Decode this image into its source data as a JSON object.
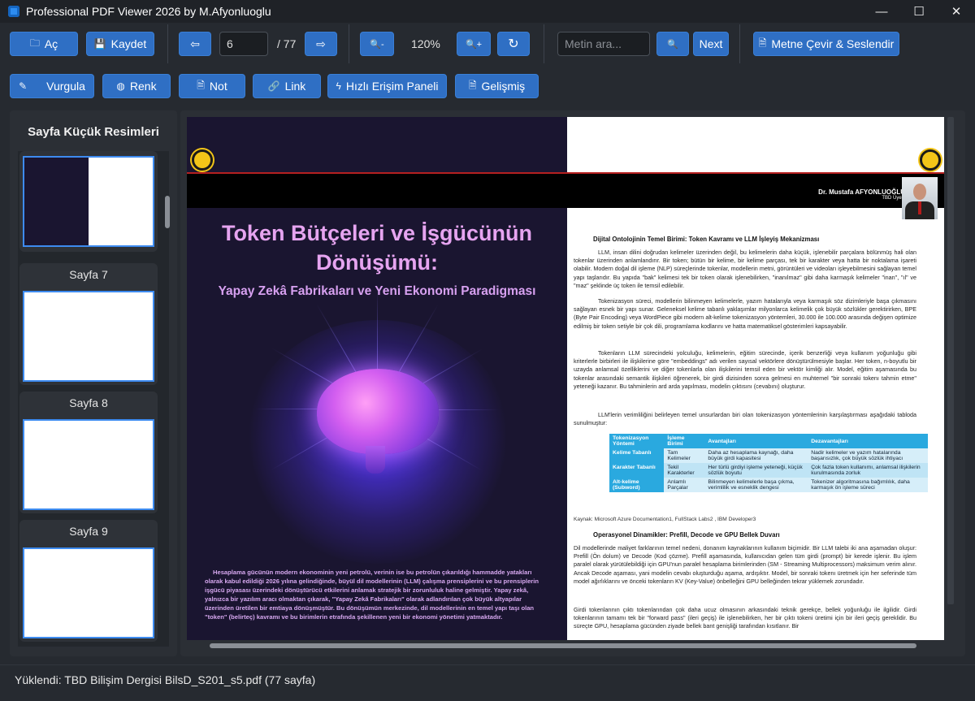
{
  "window": {
    "title": "Professional PDF Viewer 2026 by M.Afyonluoglu",
    "minimize": "—",
    "maximize": "☐",
    "close": "✕"
  },
  "toolbar1": {
    "open_label": "Aç",
    "save_label": "Kaydet",
    "prev_icon": "⇦",
    "page_value": "6",
    "page_total": "/ 77",
    "next_icon": "⇨",
    "zoom_out_icon": "🔍-",
    "zoom_level": "120%",
    "zoom_in_icon": "🔍+",
    "rotate_icon": "↻",
    "search_placeholder": "Metin ara...",
    "search_icon": "🔍",
    "next_label": "Next",
    "translate_label": "Metne Çevir & Seslendir"
  },
  "toolbar2": {
    "highlight_label": "Vurgula",
    "color_label": "Renk",
    "note_label": "Not",
    "link_label": "Link",
    "quick_access_label": "Hızlı Erişim Paneli",
    "advanced_label": "Gelişmiş"
  },
  "sidebar": {
    "title": "Sayfa Küçük Resimleri",
    "thumbnails": [
      {
        "label": ""
      },
      {
        "label": "Sayfa 7"
      },
      {
        "label": "Sayfa 8"
      },
      {
        "label": "Sayfa 9"
      }
    ]
  },
  "document": {
    "author_name": "Dr. Mustafa  AFYONLUOĞLU",
    "author_role": "TBD Üyesi",
    "title_line1": "Token Bütçeleri ve İşgücünün",
    "title_line2": "Dönüşümü:",
    "subtitle": "Yapay Zekâ Fabrikaları ve Yeni Ekonomi Paradigması",
    "left_body": "Hesaplama gücünün modern ekonominin yeni petrolü, verinin ise bu petrolün çıkarıldığı hammadde yatakları olarak kabul edildiği 2026 yılına gelindiğinde, büyül dil modellerinin (LLM) çalışma prensiplerini ve bu prensiplerin işgücü piyasası üzerindeki dönüştürücü etkilerini anlamak stratejik bir zorunluluk haline gelmiştir. Yapay zekâ, yalnızca bir yazılım aracı olmaktan çıkarak, \"Yapay Zekâ Fabrikaları\" olarak adlandırılan çok büyük altyapılar üzerinden üretilen bir emtiaya dönüşmüştür. Bu dönüşümün merkezinde, dil modellerinin en temel yapı taşı olan \"token\" (belirteç) kavramı ve bu birimlerin etrafında şekillenen yeni bir ekonomi yönetimi yatmaktadır.",
    "section1_heading": "Dijital Ontolojinin Temel Birimi: Token Kavramı ve LLM İşleyiş Mekanizması",
    "para1": "LLM, insan dilini doğrudan kelimeler üzerinden değil, bu kelimelerin daha küçük, işlenebilir parçalara bölünmüş hali olan tokenlar üzerinden anlamlandırır. Bir token; bütün bir kelime, bir kelime parçası, tek bir karakter veya hatta bir noktalama işareti olabilir. Modern doğal dil işleme (NLP) süreçlerinde tokenlar, modellerin metni, görüntüleri ve videoları işleyebilmesini sağlayan temel yapı taşlarıdır. Bu yapıda \"bak\" kelimesi tek bir token olarak işlenebilirken, \"inanılmaz\" gibi daha karmaşık kelimeler \"inan\", \"ıl\" ve \"maz\" şeklinde üç token ile temsil edilebilir.",
    "para2": "Tokenizasyon süreci, modellerin bilinmeyen kelimelerle, yazım hatalarıyla veya karmaşık söz dizimleriyle başa çıkmasını sağlayan esnek bir yapı sunar. Geleneksel kelime tabanlı yaklaşımlar milyonlarca kelimelik çok büyük sözlükler gerektirirken, BPE (Byte Pair Encoding) veya WordPiece gibi modern alt-kelime tokenizasyon yöntemleri, 30.000 ile 100.000 arasında değişen optimize edilmiş bir token setiyle bir çok dili, programlama kodlarını ve hatta matematiksel gösterimleri kapsayabilir.",
    "para3": "Tokenların LLM sürecindeki yolculuğu, kelimelerin, eğitim sürecinde, içerik benzerliği veya kullanım yoğunluğu gibi kriterlerle birbirleri ile ilişkilerine göre \"embeddings\" adı verilen sayısal vektörlere dönüştürülmesiyle başlar. Her token, n-boyutlu bir uzayda anlamsal özelliklerini ve diğer tokenlarla olan ilişkilerini temsil eden bir vektör kimliği alır. Model, eğitim aşamasında bu tokenlar arasındaki semantik ilişkileri öğrenerek, bir girdi dizisinden sonra gelmesi en muhtemel \"bir sonraki tokenı tahmin etme\" yeteneği kazanır. Bu tahminlerin ard arda yapılması, modelin çıktısını (cevabını) oluşturur.",
    "para4": "LLM'lerin verimliliğini belirleyen temel unsurlardan biri olan tokenizasyon yöntemlerinin karşılaştırması aşağıdaki tabloda sunulmuştur:",
    "table_headers": [
      "Tokenizasyon Yöntemi",
      "İşleme Birimi",
      "Avantajları",
      "Dezavantajları"
    ],
    "table_rows": [
      [
        "Kelime Tabanlı",
        "Tam Kelimeler",
        "Daha az hesaplama kaynağı, daha büyük girdi kapasitesi",
        "Nadir kelimeler ve yazım hatalarında başarısızlık, çok büyük sözlük ihtiyacı"
      ],
      [
        "Karakter Tabanlı",
        "Tekil Karakterler",
        "Her türlü girdiyi işleme yeteneği, küçük sözlük boyutu",
        "Çok fazla token kullanımı, anlamsal ilişkilerin kurulmasında zorluk"
      ],
      [
        "Alt-kelime (Subword)",
        "Anlamlı Parçalar",
        "Bilinmeyen kelimelerle başa çıkma, verimlilik ve esneklik dengesi",
        "Tokenizer algoritmasına bağımlılık, daha karmaşık ön işleme süreci"
      ]
    ],
    "table_caption": "Kaynak: Microsoft Azure Documentation1, FullStack Labs2 , IBM Developer3",
    "section2_heading": "Operasyonel Dinamikler: Prefill, Decode ve GPU Bellek Duvarı",
    "para5": "Dil modellerinde maliyet farklarının temel nedeni, donanım kaynaklarının kullanım biçimidir. Bir LLM talebi iki ana aşamadan oluşur: Prefill (Ön dolum) ve Decode (Kod çözme). Prefill aşamasında, kullanıcıdan gelen tüm girdi (prompt) bir kerede işlenir. Bu işlem paralel olarak yürütülebildiği için GPU'nun paralel hesaplama birimlerinden (SM - Streaming Multiprocessors) maksimum verim alınır. Ancak Decode aşaması, yani modelin cevabı oluşturduğu aşama, ardışıktır. Model, bir sonraki tokenı üretmek için her seferinde tüm model ağırlıklarını ve önceki tokenların KV (Key-Value) önbelleğini GPU belleğinden tekrar yüklemek zorundadır.",
    "para6": "Girdi tokenlarının çıktı tokenlarından çok daha ucuz olmasının arkasındaki teknik gerekçe, bellek yoğunluğu ile ilgilidir. Girdi tokenlarının tamamı tek bir \"forward pass\" (ileri geçiş) ile işlenebilirken, her bir çıktı tokeni üretimi için bir ileri geçiş gereklidir. Bu süreçte GPU, hesaplama gücünden ziyade bellek bant genişliği tarafından kısıtlanır. Bir"
  },
  "status": {
    "text": "Yüklendi: TBD Bilişim Dergisi BilsD_S201_s5.pdf (77 sayfa)"
  },
  "colors": {
    "button": "#2f6fc4",
    "background": "#262a30",
    "title_accent": "#e6a4f0",
    "table_header": "#2aa9df"
  }
}
